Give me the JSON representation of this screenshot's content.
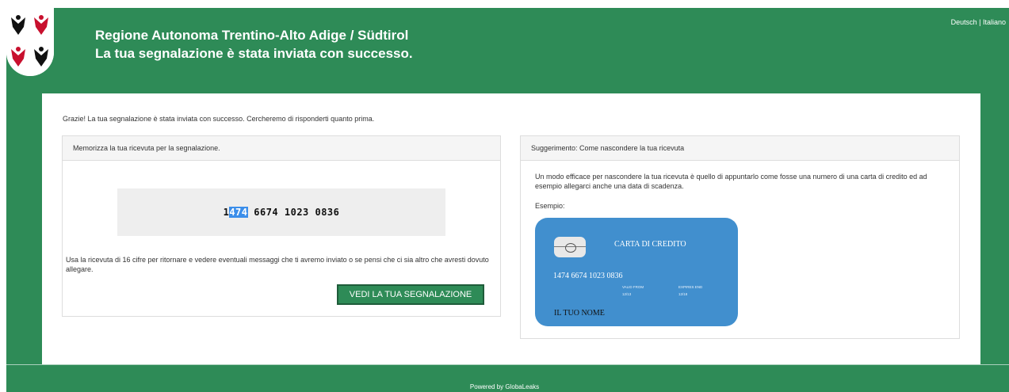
{
  "header": {
    "region_title": "Regione Autonoma Trentino-Alto Adige / Südtirol",
    "subtitle": "La tua segnalazione è stata inviata con successo.",
    "lang_deutsch": "Deutsch |",
    "lang_italiano": "Italiano"
  },
  "main": {
    "thanks_message": "Grazie! La tua segnalazione è stata inviata con successo. Cercheremo di risponderti quanto prima.",
    "receipt_panel": {
      "heading": "Memorizza la tua ricevuta per la segnalazione.",
      "receipt_selected": "474",
      "receipt_first_digit": "1",
      "receipt_rest": " 6674 1023 0836",
      "note": "Usa la ricevuta di 16 cifre per ritornare e vedere eventuali messaggi che ti avremo inviato o se pensi che ci sia altro che avresti dovuto allegare.",
      "view_button": "VEDI LA TUA SEGNALAZIONE"
    },
    "tip_panel": {
      "heading": "Suggerimento: Come nascondere la tua ricevuta",
      "text": "Un modo efficace per nascondere la tua ricevuta è quello di appuntarlo come fosse una numero di una carta di credito ed ad esempio allegarci anche una data di scadenza.",
      "example_label": "Esempio:",
      "card": {
        "title": "CARTA DI CREDITO",
        "number": "1474 6674 1023 0836",
        "valid_from_label": "VALID FROM",
        "valid_from_value": "12/13",
        "expires_label": "EXPIRES END",
        "expires_value": "12/18",
        "name": "IL TUO NOME"
      }
    }
  },
  "footer": {
    "text": "Powered by GlobaLeaks"
  },
  "colors": {
    "brand_green": "#2e8b57",
    "card_blue": "#418fce",
    "selection_blue": "#3b8eea"
  }
}
